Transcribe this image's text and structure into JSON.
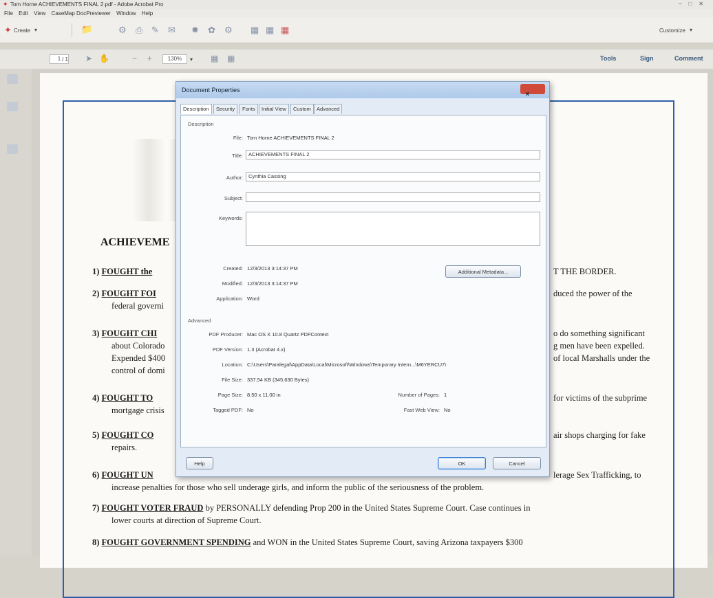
{
  "window": {
    "title": "Tom Horne ACHIEVEMENTS FINAL 2.pdf - Adobe Acrobat Pro"
  },
  "menu": [
    "File",
    "Edit",
    "View",
    "CaseMap DocPreviewer",
    "Window",
    "Help"
  ],
  "toolbar": {
    "create_label": "Create",
    "customize_label": "Customize",
    "page_current": "1",
    "page_total": "/ 1",
    "zoom": "130%",
    "tools_label": "Tools",
    "sign_label": "Sign",
    "comment_label": "Comment"
  },
  "document": {
    "heading": "ACHIEVEME",
    "lines": [
      {
        "num": "1)",
        "bold": "FOUGHT the",
        "rest": "",
        "tail": "T THE BORDER."
      },
      {
        "num": "2)",
        "bold": "FOUGHT FOI",
        "rest": "",
        "tail": "duced the power of the"
      },
      {
        "num": "",
        "bold": "",
        "rest": "federal governi",
        "tail": ""
      },
      {
        "num": "3)",
        "bold": "FOUGHT CHI",
        "rest": "",
        "tail": "o do something significant"
      },
      {
        "num": "",
        "bold": "",
        "rest": "about Colorado",
        "tail": "g men have been expelled."
      },
      {
        "num": "",
        "bold": "",
        "rest": "Expended $400",
        "tail": "of local Marshalls under the"
      },
      {
        "num": "",
        "bold": "",
        "rest": "control of domi",
        "tail": ""
      },
      {
        "num": "4)",
        "bold": "FOUGHT TO",
        "rest": "",
        "tail": "for victims of the subprime"
      },
      {
        "num": "",
        "bold": "",
        "rest": "mortgage crisis",
        "tail": ""
      },
      {
        "num": "5)",
        "bold": "FOUGHT CO",
        "rest": "",
        "tail": "air shops charging for fake"
      },
      {
        "num": "",
        "bold": "",
        "rest": "repairs.",
        "tail": ""
      },
      {
        "num": "6)",
        "bold": "FOUGHT UN",
        "rest": "",
        "tail": "lerage Sex Trafficking, to"
      },
      {
        "num": "",
        "bold": "",
        "rest": "increase penalties for those who sell underage girls, and inform the public of the seriousness of the problem.",
        "tail": ""
      },
      {
        "num": "7)",
        "bold": "FOUGHT VOTER FRAUD",
        "rest": " by PERSONALLY defending Prop 200 in the United States Supreme Court. Case continues in",
        "tail": ""
      },
      {
        "num": "",
        "bold": "",
        "rest": "lower courts at direction of Supreme Court.",
        "tail": ""
      },
      {
        "num": "8)",
        "bold": "FOUGHT GOVERNMENT SPENDING",
        "rest": " and WON in the United States Supreme Court, saving Arizona taxpayers $300",
        "tail": ""
      }
    ]
  },
  "dialog": {
    "title": "Document Properties",
    "close_label": "x",
    "tabs": [
      "Description",
      "Security",
      "Fonts",
      "Initial View",
      "Custom",
      "Advanced"
    ],
    "description_group": "Description",
    "file_label": "File:",
    "file_value": "Tom Horne ACHIEVEMENTS FINAL 2",
    "title_label": "Title:",
    "title_value": "ACHIEVEMENTS FINAL 2",
    "author_label": "Author:",
    "author_value": "Cynthia Cassing",
    "subject_label": "Subject:",
    "subject_value": "",
    "keywords_label": "Keywords:",
    "keywords_value": "",
    "created_label": "Created:",
    "created_value": "12/3/2013 3:14:37 PM",
    "modified_label": "Modified:",
    "modified_value": "12/3/2013 3:14:37 PM",
    "application_label": "Application:",
    "application_value": "Word",
    "additional_metadata_label": "Additional Metadata...",
    "advanced_group": "Advanced",
    "pdf_producer_label": "PDF Producer:",
    "pdf_producer_value": "Mac OS X 10.8 Quartz PDFContext",
    "pdf_version_label": "PDF Version:",
    "pdf_version_value": "1.3 (Acrobat 4.x)",
    "location_label": "Location:",
    "location_value": "C:\\Users\\Paralegal\\AppData\\Local\\Microsoft\\Windows\\Temporary Intern...\\M6YERCU7\\",
    "file_size_label": "File Size:",
    "file_size_value": "337.54 KB (345,630 Bytes)",
    "page_size_label": "Page Size:",
    "page_size_value": "8.50 x 11.00 in",
    "num_pages_label": "Number of Pages:",
    "num_pages_value": "1",
    "tagged_pdf_label": "Tagged PDF:",
    "tagged_pdf_value": "No",
    "fast_web_label": "Fast Web View:",
    "fast_web_value": "No",
    "help_label": "Help",
    "ok_label": "OK",
    "cancel_label": "Cancel"
  }
}
